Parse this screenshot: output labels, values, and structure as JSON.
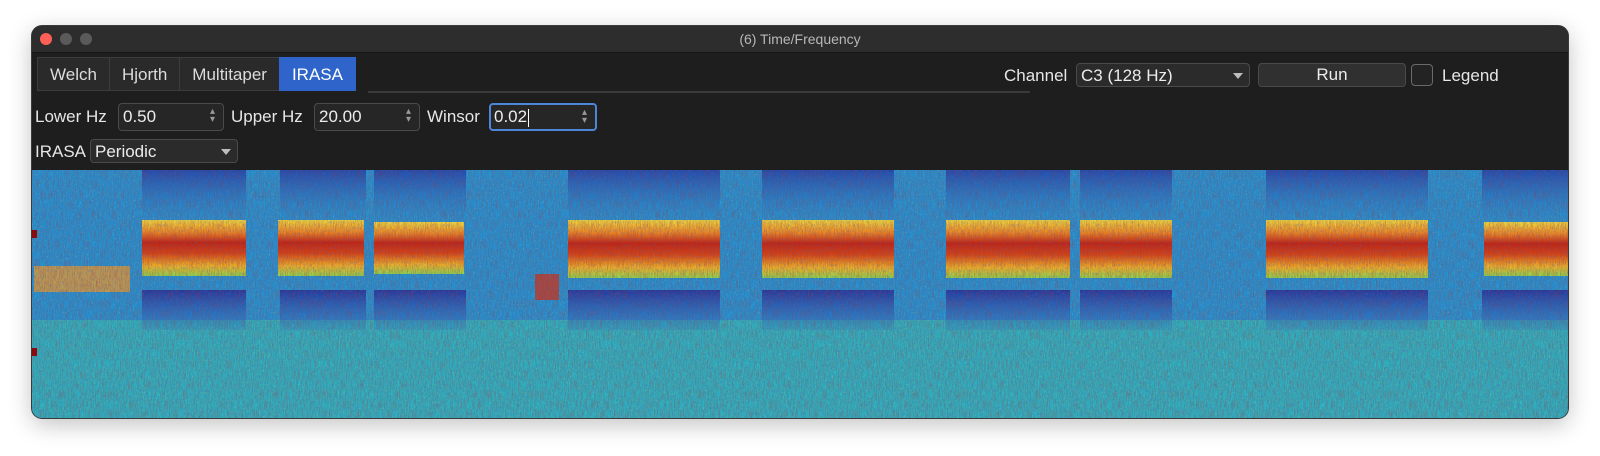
{
  "window": {
    "title": "(6) Time/Frequency"
  },
  "tabs": [
    {
      "label": "Welch",
      "active": false
    },
    {
      "label": "Hjorth",
      "active": false
    },
    {
      "label": "Multitaper",
      "active": false
    },
    {
      "label": "IRASA",
      "active": true
    }
  ],
  "controls": {
    "channel_label": "Channel",
    "channel_value": "C3 (128 Hz)",
    "run_label": "Run",
    "legend_label": "Legend",
    "legend_checked": false,
    "lower_label": "Lower Hz",
    "lower_value": "0.50",
    "upper_label": "Upper Hz",
    "upper_value": "20.00",
    "winsor_label": "Winsor",
    "winsor_value": "0.02",
    "irasa_label": "IRASA",
    "irasa_mode": "Periodic"
  },
  "colors": {
    "accent": "#2f65ca",
    "colormap": [
      "#1a2a8c",
      "#1f8fd0",
      "#2fc6b0",
      "#e6e23a",
      "#f07a1c",
      "#b2190f",
      "#7a0b08"
    ]
  }
}
